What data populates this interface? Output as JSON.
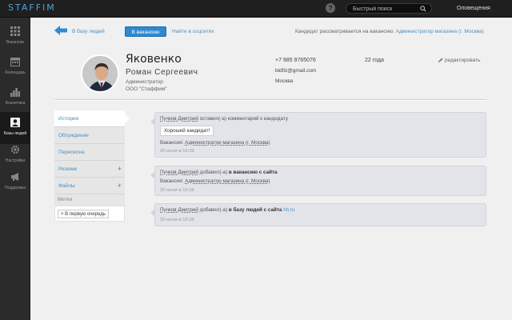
{
  "topbar": {
    "logo": "STAFFIM",
    "help": "?",
    "search_placeholder": "Быстрый поиск",
    "notifications": "Оповещения"
  },
  "sidebar": {
    "items": [
      {
        "label": "Вакансии",
        "icon": "grid-icon"
      },
      {
        "label": "Календарь",
        "icon": "calendar-icon"
      },
      {
        "label": "Аналитика",
        "icon": "chart-icon"
      },
      {
        "label": "Базы людей",
        "icon": "person-icon",
        "active": true
      },
      {
        "label": "Настройки",
        "icon": "gear-icon"
      },
      {
        "label": "Поддержка",
        "icon": "megaphone-icon"
      }
    ]
  },
  "header": {
    "back_label": "В базу людей",
    "vacancy_button": "В вакансию",
    "social_link": "Найти в соцсетях",
    "status_text": "Кандидат рассматривается на вакансию:",
    "status_vacancy": "Администратор магазина (г. Москва)"
  },
  "profile": {
    "last_name": "Яковенко",
    "first_name": "Роман Сергеевич",
    "position": "Администратор",
    "company": "ООО \"Стаффим\"",
    "phone": "+7 985 9765076",
    "email": "bidfiz@gmail.com",
    "city": "Москва",
    "age": "22 года",
    "edit_label": "редактировать"
  },
  "tabs": [
    {
      "label": "История",
      "active": true
    },
    {
      "label": "Обсуждение"
    },
    {
      "label": "Переписка"
    },
    {
      "label": "Резюме",
      "plus": "+"
    },
    {
      "label": "Файлы",
      "plus": "+"
    }
  ],
  "tags": {
    "heading": "Метки",
    "items": [
      "× В первую очередь"
    ]
  },
  "events": [
    {
      "author": "Пучков Дмитрий",
      "action": "оставил(-а) комментарий к кандидату",
      "comment": "Хороший кандидат!",
      "vacancy_label": "Вакансия:",
      "vacancy": "Администратор магазина (г. Москва)",
      "date": "20 июня в 16:36"
    },
    {
      "author": "Пучков Дмитрий",
      "action": "добавил(-а)",
      "action_bold": "в вакансию с сайта",
      "vacancy_label": "Вакансия:",
      "vacancy": "Администратор магазина (г. Москва)",
      "date": "20 июня в 16:36"
    },
    {
      "author": "Пучков Дмитрий",
      "action": "добавил(-а)",
      "action_bold": "в базу людей с сайта",
      "source": "hh.ru",
      "date": "20 июня в 16:36"
    }
  ]
}
